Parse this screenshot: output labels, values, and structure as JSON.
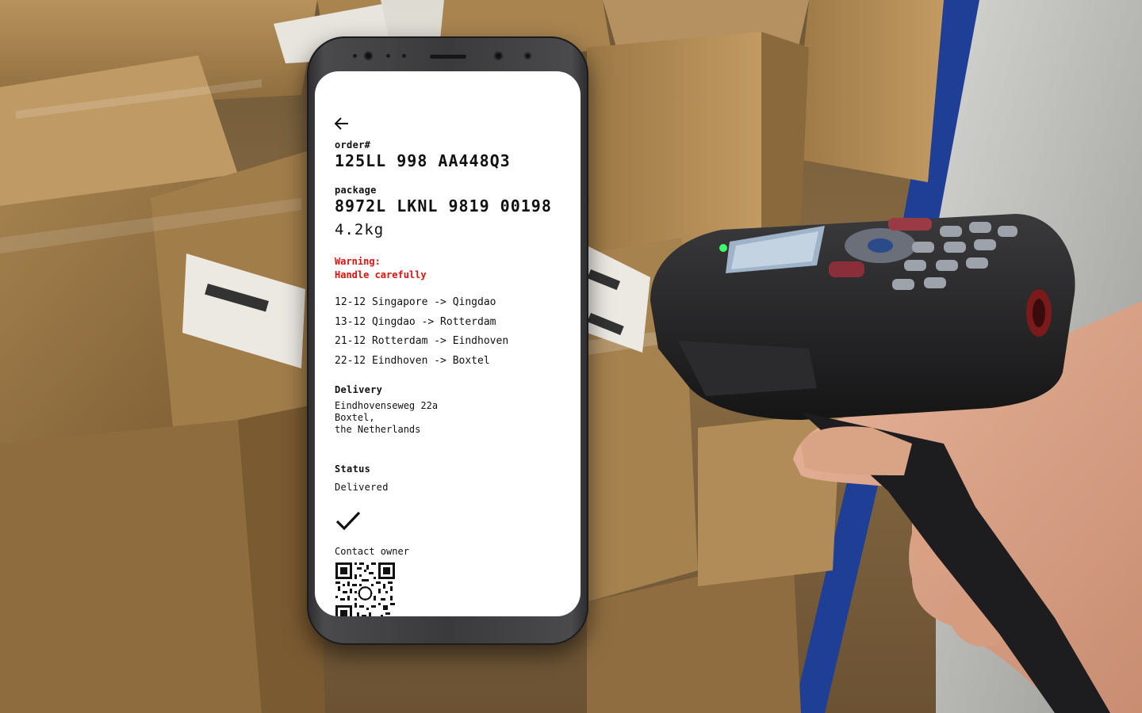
{
  "scene": {
    "background": "warehouse photo: stacked cardboard boxes and a hand holding a barcode scanner"
  },
  "screen": {
    "order_label": "order#",
    "order_number": "125LL 998 AA448Q3",
    "package_label": "package",
    "package_number": "8972L LKNL 9819 00198",
    "weight": "4.2kg",
    "warning_title": "Warning:",
    "warning_text": "Handle carefully",
    "route": [
      "12-12 Singapore -> Qingdao",
      "13-12 Qingdao -> Rotterdam",
      "21-12 Rotterdam -> Eindhoven",
      "22-12 Eindhoven -> Boxtel"
    ],
    "delivery_label": "Delivery",
    "delivery_address": "Eindhovenseweg 22a\nBoxtel,\nthe Netherlands",
    "status_label": "Status",
    "status_value": "Delivered",
    "contact_label": "Contact owner"
  },
  "icons": {
    "back": "arrow-left-icon",
    "status": "checkmark-icon",
    "qr": "qr-code"
  },
  "colors": {
    "warning": "#e0110f",
    "text": "#111111",
    "screen_bg": "#ffffff",
    "phone_body": "#3a3a3c"
  }
}
